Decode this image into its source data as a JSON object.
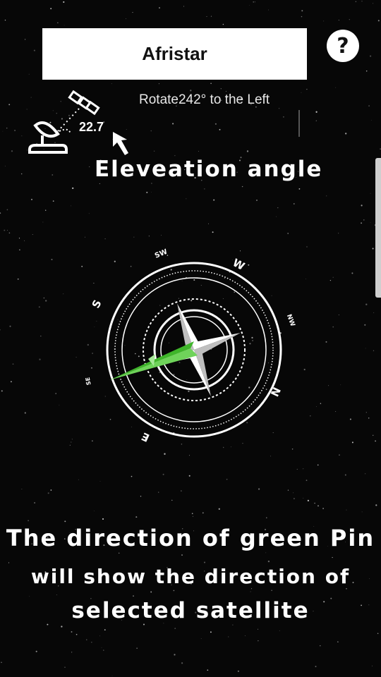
{
  "satellite": {
    "name": "Afristar"
  },
  "help": {
    "label": "?"
  },
  "rotation": {
    "text": "Rotate242° to the Left"
  },
  "elevation": {
    "value": "22.7",
    "label": "Eleveation angle"
  },
  "compass": {
    "directions": [
      "SW",
      "W",
      "NW",
      "N",
      "E",
      "S",
      "SE"
    ],
    "labels": {
      "sw": "SW",
      "w": "W",
      "nw": "NW",
      "n": "N",
      "e": "E",
      "s": "S",
      "se": "SE"
    }
  },
  "caption": {
    "line1": "The direction of green Pin",
    "line2": "will show the direction of",
    "line3": "selected satellite"
  },
  "colors": {
    "pin": "#3fb52a",
    "background": "#070707",
    "box": "#ffffff"
  }
}
